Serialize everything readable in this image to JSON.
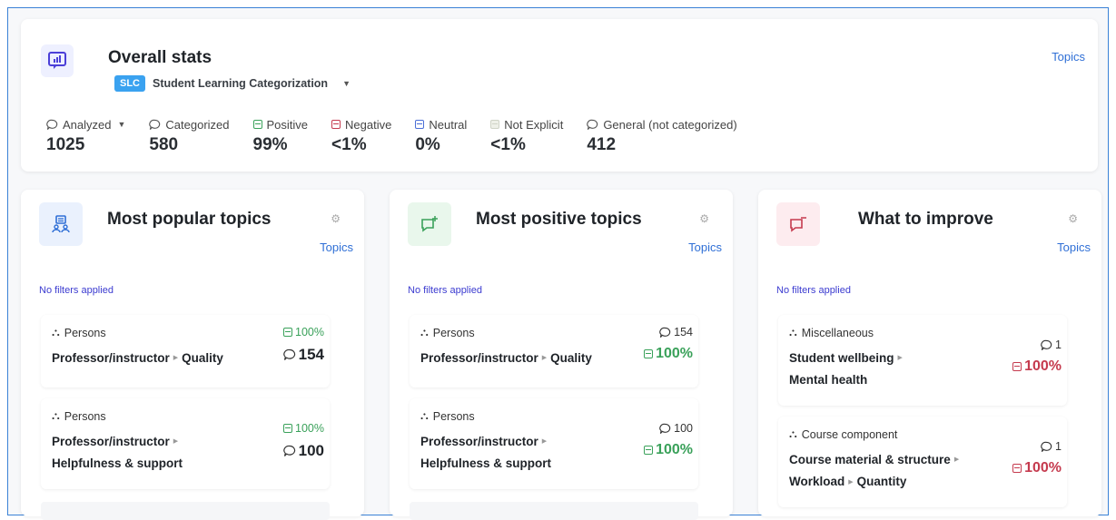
{
  "overall": {
    "title": "Overall stats",
    "badge": "SLC",
    "category": "Student Learning Categorization",
    "topics_link": "Topics",
    "stats": [
      {
        "label": "Analyzed",
        "value": "1025",
        "icon": "comment-icon",
        "dropdown": true
      },
      {
        "label": "Categorized",
        "value": "580",
        "icon": "comment-icon"
      },
      {
        "label": "Positive",
        "value": "99%",
        "icon": "positive-icon",
        "color": "#3aa15a"
      },
      {
        "label": "Negative",
        "value": "<1%",
        "icon": "negative-icon",
        "color": "#c53a4e"
      },
      {
        "label": "Neutral",
        "value": "0%",
        "icon": "neutral-icon",
        "color": "#4a6ed6"
      },
      {
        "label": "Not Explicit",
        "value": "<1%",
        "icon": "not-explicit-icon",
        "color": "#d8dcd0"
      },
      {
        "label": "General (not categorized)",
        "value": "412",
        "icon": "comment-icon"
      }
    ]
  },
  "panels": [
    {
      "id": "popular",
      "title": "Most popular topics",
      "topics_link": "Topics",
      "filter": "No filters applied",
      "icon": "people-icon",
      "items": [
        {
          "category": "Persons",
          "topic_a": "Professor/instructor",
          "topic_b": "Quality",
          "count": "154",
          "pct": "100%",
          "pct_type": "positive"
        },
        {
          "category": "Persons",
          "topic_a": "Professor/instructor",
          "topic_b": "Helpfulness & support",
          "count": "100",
          "pct": "100%",
          "pct_type": "positive"
        }
      ]
    },
    {
      "id": "positive",
      "title": "Most positive topics",
      "topics_link": "Topics",
      "filter": "No filters applied",
      "icon": "comment-plus-icon",
      "items": [
        {
          "category": "Persons",
          "topic_a": "Professor/instructor",
          "topic_b": "Quality",
          "count": "154",
          "pct": "100%",
          "pct_type": "positive"
        },
        {
          "category": "Persons",
          "topic_a": "Professor/instructor",
          "topic_b": "Helpfulness & support",
          "count": "100",
          "pct": "100%",
          "pct_type": "positive"
        }
      ]
    },
    {
      "id": "improve",
      "title": "What to improve",
      "topics_link": "Topics",
      "filter": "No filters applied",
      "icon": "comment-minus-icon",
      "items": [
        {
          "category": "Miscellaneous",
          "topic_a": "Student wellbeing",
          "topic_b": "Mental health",
          "count": "1",
          "pct": "100%",
          "pct_type": "negative"
        },
        {
          "category": "Course component",
          "topic_a": "Course material & structure",
          "topic_b": "Workload",
          "topic_c": "Quantity",
          "count": "1",
          "pct": "100%",
          "pct_type": "negative"
        }
      ]
    }
  ],
  "colors": {
    "accent": "#2f6fd6",
    "positive": "#3aa15a",
    "negative": "#c53a4e",
    "badge": "#3aa2f0"
  }
}
